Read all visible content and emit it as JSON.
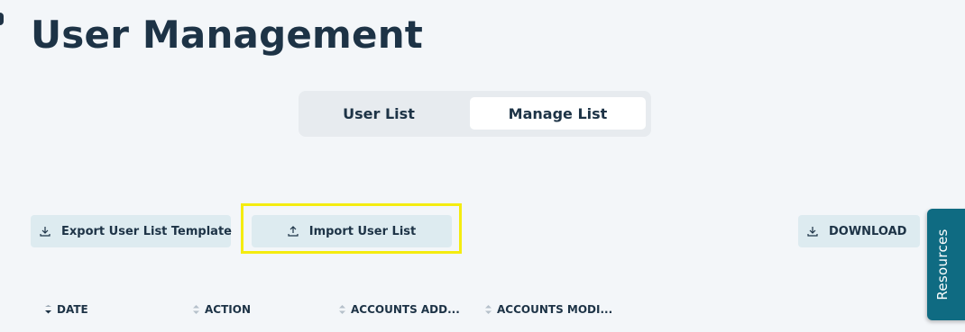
{
  "page": {
    "title": "User Management"
  },
  "tabs": [
    {
      "label": "User List",
      "active": false
    },
    {
      "label": "Manage List",
      "active": true
    }
  ],
  "actions": {
    "export_label": "Export User List Template",
    "import_label": "Import User List",
    "download_label": "DOWNLOAD"
  },
  "resources_tab": {
    "label": "Resources"
  },
  "table": {
    "columns": [
      {
        "label": "DATE",
        "sort": "desc"
      },
      {
        "label": "ACTION",
        "sort": "none"
      },
      {
        "label": "ACCOUNTS ADD...",
        "sort": "none"
      },
      {
        "label": "ACCOUNTS MODI...",
        "sort": "none"
      }
    ]
  },
  "colors": {
    "background": "#f3f6f9",
    "text": "#1d3346",
    "button_bg": "#ddebf0",
    "tab_track": "#e7ebef",
    "highlight": "#f4ec10",
    "resources_bg": "#0f6b82"
  },
  "icons": {
    "export": "download-icon",
    "import": "upload-icon",
    "download": "download-icon",
    "sort_active": "sort-desc-icon",
    "sort_inactive": "sort-icon"
  }
}
